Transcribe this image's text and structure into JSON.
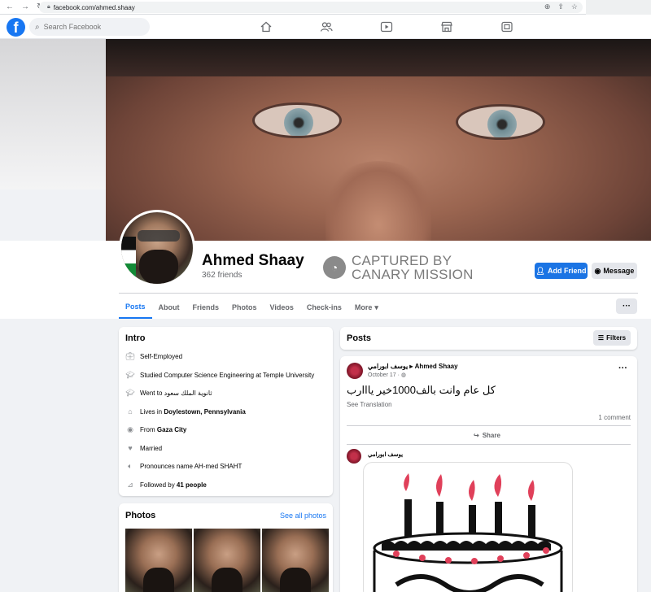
{
  "browser": {
    "url": "facebook.com/ahmed.shaay"
  },
  "search": {
    "placeholder": "Search Facebook"
  },
  "profile": {
    "name": "Ahmed Shaay",
    "friends": "362 friends",
    "add_friend": "Add Friend",
    "message": "Message"
  },
  "watermark": {
    "line1": "CAPTURED BY",
    "line2": "CANARY MISSION"
  },
  "tabs": [
    {
      "label": "Posts"
    },
    {
      "label": "About"
    },
    {
      "label": "Friends"
    },
    {
      "label": "Photos"
    },
    {
      "label": "Videos"
    },
    {
      "label": "Check-ins"
    },
    {
      "label": "More"
    }
  ],
  "intro": {
    "title": "Intro",
    "self_employed": "Self-Employed",
    "studied": "Studied Computer Science Engineering at Temple University",
    "went_to": "Went to ثانوية الملك سعود",
    "lives_prefix": "Lives in ",
    "lives_city": "Doylestown, Pennsylvania",
    "from_prefix": "From ",
    "from_city": "Gaza City",
    "married": "Married",
    "pronounces": "Pronounces name AH-med SHAHT",
    "followed_prefix": "Followed by ",
    "followed_count": "41 people"
  },
  "photos": {
    "title": "Photos",
    "see_all": "See all photos"
  },
  "posts": {
    "title": "Posts",
    "filters": "Filters",
    "author": "يوسف ابورامي ▸ Ahmed Shaay",
    "date": "October 17 · ◍",
    "text": "كل عام وانت بالف1000خير يااارب",
    "see_translation": "See Translation",
    "comments": "1 comment",
    "share": "Share",
    "commenter": "يوسف ابورامي"
  },
  "colors": {
    "accent": "#1877f2",
    "background": "#f0f2f5"
  }
}
